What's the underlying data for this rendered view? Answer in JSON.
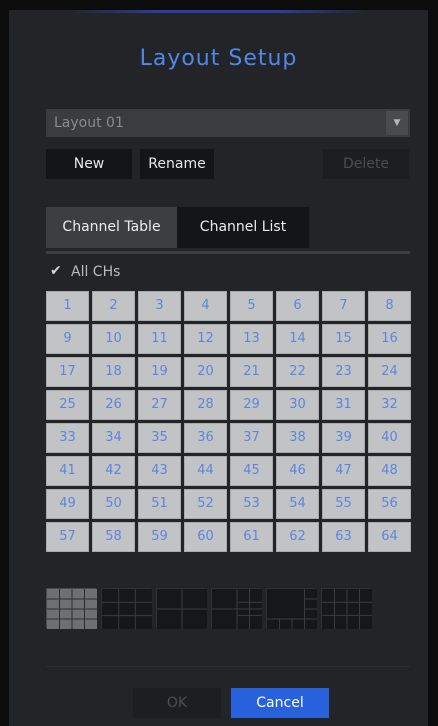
{
  "dialog": {
    "title": "Layout Setup",
    "layout_select": {
      "value": "Layout 01",
      "arrow_icon": "triangle-down-icon"
    },
    "buttons": {
      "new": "New",
      "rename": "Rename",
      "delete": "Delete"
    },
    "tabs": [
      {
        "label": "Channel Table",
        "active": true
      },
      {
        "label": "Channel List",
        "active": false
      }
    ],
    "all_chs": {
      "label": "All CHs",
      "checked": true
    },
    "channels": [
      "1",
      "2",
      "3",
      "4",
      "5",
      "6",
      "7",
      "8",
      "9",
      "10",
      "11",
      "12",
      "13",
      "14",
      "15",
      "16",
      "17",
      "18",
      "19",
      "20",
      "21",
      "22",
      "23",
      "24",
      "25",
      "26",
      "27",
      "28",
      "29",
      "30",
      "31",
      "32",
      "33",
      "34",
      "35",
      "36",
      "37",
      "38",
      "39",
      "40",
      "41",
      "42",
      "43",
      "44",
      "45",
      "46",
      "47",
      "48",
      "49",
      "50",
      "51",
      "52",
      "53",
      "54",
      "55",
      "56",
      "57",
      "58",
      "59",
      "60",
      "61",
      "62",
      "63",
      "64"
    ],
    "layout_modes": [
      {
        "icon": "layout-16-split-icon",
        "selected": true
      },
      {
        "icon": "layout-9-split-icon",
        "selected": false
      },
      {
        "icon": "layout-4-split-icon",
        "selected": false
      },
      {
        "icon": "layout-1-plus-5-icon",
        "selected": false
      },
      {
        "icon": "layout-1-plus-7-icon",
        "selected": false
      },
      {
        "icon": "layout-12-split-icon",
        "selected": false
      }
    ],
    "footer": {
      "ok": "OK",
      "cancel": "Cancel"
    },
    "colors": {
      "accent": "#4f88e9",
      "cancel": "#2861dc",
      "cell_text": "#5c86de"
    }
  }
}
